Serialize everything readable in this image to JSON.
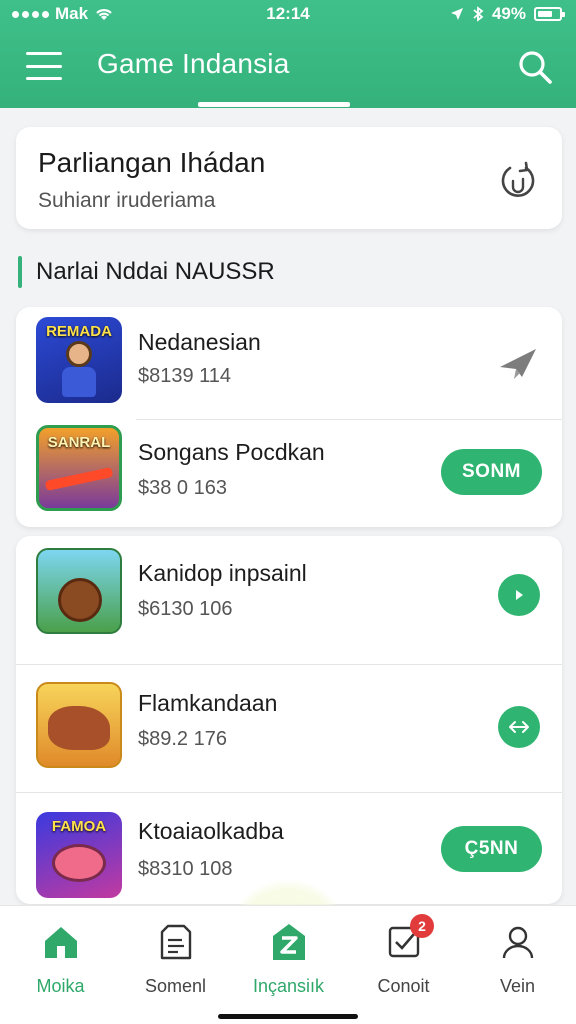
{
  "status_bar": {
    "carrier": "Mak",
    "time": "12:14",
    "battery": "49%"
  },
  "header": {
    "title": "Game Indansia"
  },
  "banner": {
    "title": "Parliangan Ihádan",
    "subtitle": "Suhianr iruderiama"
  },
  "section": {
    "title": "Narlai Nddai NAUSSR"
  },
  "games": [
    {
      "thumb_text": "REMADA",
      "name": "Nedanesian",
      "price": "$8139 114",
      "action": "airplane-icon"
    },
    {
      "thumb_text": "SANRAL",
      "name": "Songans Pocdkan",
      "price": "$38 0 163",
      "action_label": "SONM"
    },
    {
      "thumb_text": "",
      "name": "Kanidop inpsainl",
      "price": "$6130 106",
      "action": "play-icon"
    },
    {
      "thumb_text": "",
      "name": "Flamkandaan",
      "price": "$89.2 176",
      "action": "swap-icon"
    },
    {
      "thumb_text": "FAMOA",
      "name": "Ktoaiaolkadba",
      "price": "$8310 108",
      "action_label": "Ç5NN"
    }
  ],
  "bottom_nav": [
    {
      "label": "Moika",
      "icon": "home-icon",
      "active": true
    },
    {
      "label": "Somenl",
      "icon": "document-icon",
      "active": false
    },
    {
      "label": "Inçansiık",
      "icon": "z-store-icon",
      "active": true
    },
    {
      "label": "Conoit",
      "icon": "checkbox-icon",
      "active": false,
      "badge": "2"
    },
    {
      "label": "Vein",
      "icon": "user-icon",
      "active": false
    }
  ],
  "colors": {
    "accent": "#35b27c",
    "button": "#2fb571",
    "badge": "#e23b3b"
  }
}
